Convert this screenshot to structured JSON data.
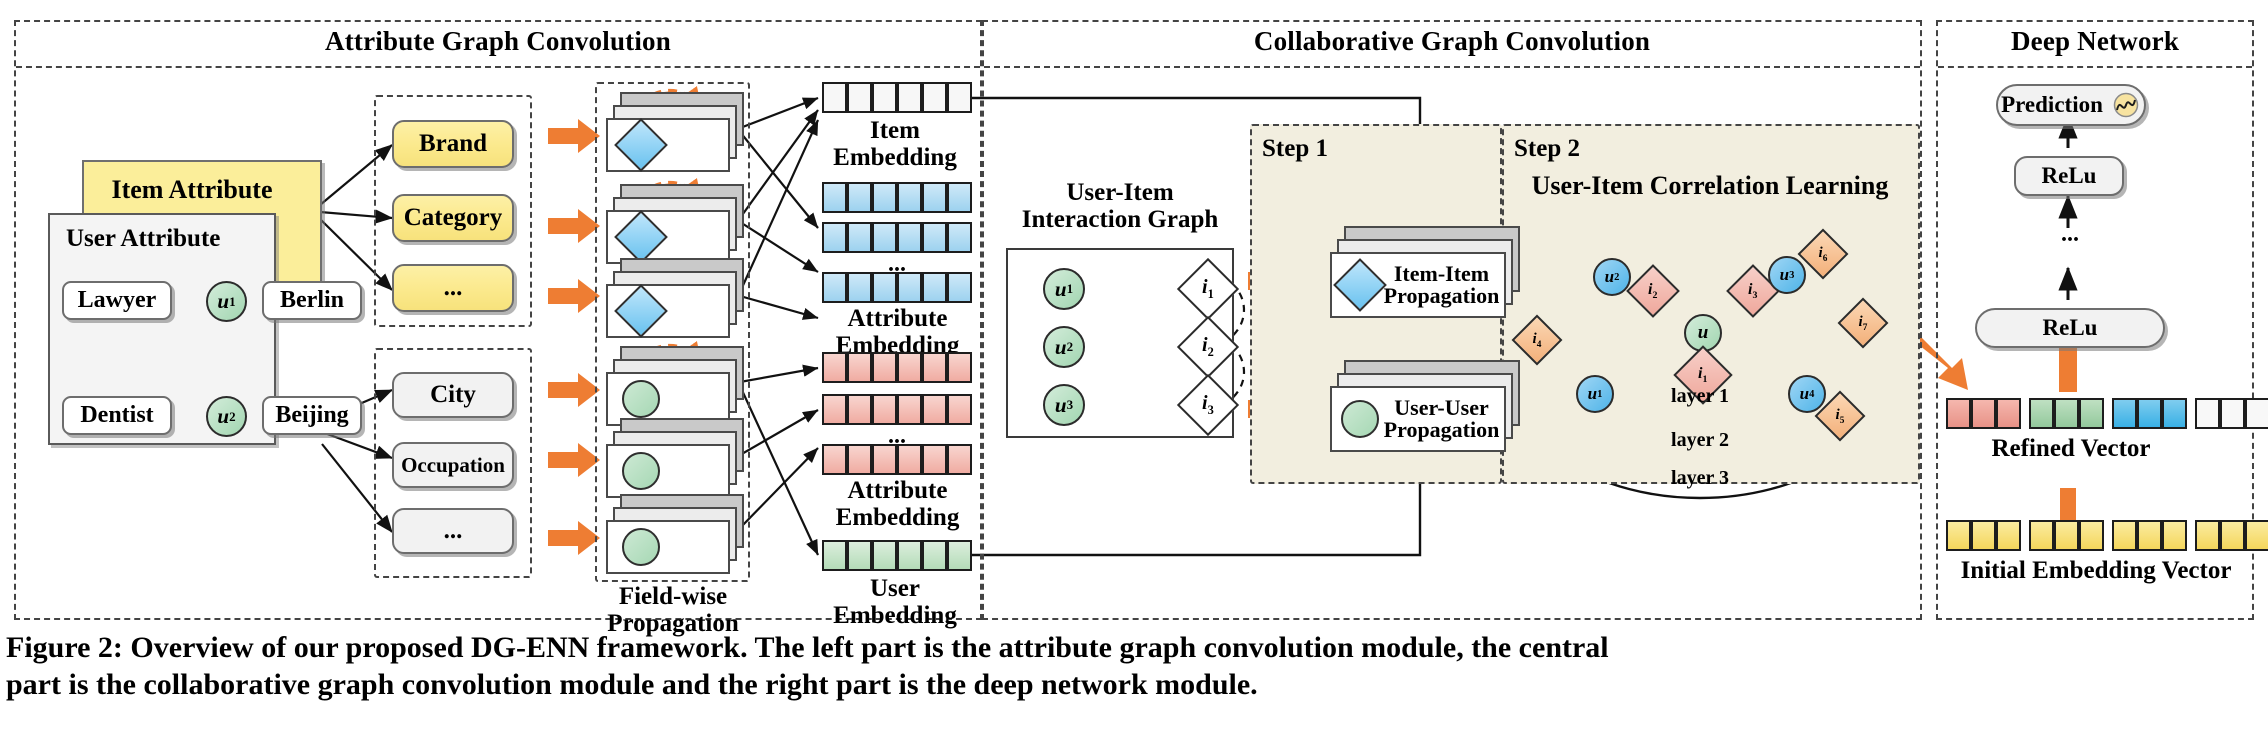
{
  "figure": {
    "caption_line1": "Figure 2: Overview of our proposed DG-ENN framework. The left part is the attribute graph convolution module, the central",
    "caption_line2": "part is the collaborative graph convolution module and the right part is the deep network module."
  },
  "panels": {
    "left": {
      "title": "Attribute Graph Convolution"
    },
    "center": {
      "title": "Collaborative Graph Convolution"
    },
    "right": {
      "title": "Deep Network"
    }
  },
  "left_panel": {
    "item_attribute_label": "Item Attribute",
    "user_attribute_label": "User Attribute",
    "user_graph": {
      "nodes": [
        {
          "id": "lawyer",
          "label": "Lawyer"
        },
        {
          "id": "berlin",
          "label": "Berlin"
        },
        {
          "id": "dentist",
          "label": "Dentist"
        },
        {
          "id": "beijing",
          "label": "Beijing"
        },
        {
          "id": "u1",
          "label": "u",
          "sub": "1"
        },
        {
          "id": "u2",
          "label": "u",
          "sub": "2"
        }
      ]
    },
    "item_fields": [
      "Brand",
      "Category",
      "..."
    ],
    "user_fields": [
      "City",
      "Occupation",
      "..."
    ],
    "field_wise_label_l1": "Field-wise",
    "field_wise_label_l2": "Propagation",
    "item_embedding_label_l1": "Item",
    "item_embedding_label_l2": "Embedding",
    "attribute_embedding_label_l1": "Attribute",
    "attribute_embedding_label_l2": "Embedding",
    "user_embedding_label_l1": "User",
    "user_embedding_label_l2": "Embedding",
    "ellipsis": "...",
    "colors": {
      "item_cell": "#f7f7f7",
      "item_attr_cell": "#a8d9f2",
      "user_attr_cell": "#f3b3ac",
      "user_cell": "#bfdcc2",
      "yellow": "#fbe98c",
      "orange": "#ee7d33"
    }
  },
  "center_panel": {
    "interaction_graph_label_l1": "User-Item",
    "interaction_graph_label_l2": "Interaction Graph",
    "graph_nodes": {
      "users": [
        {
          "label": "u",
          "sub": "1"
        },
        {
          "label": "u",
          "sub": "2"
        },
        {
          "label": "u",
          "sub": "3"
        }
      ],
      "items": [
        {
          "label": "i",
          "sub": "1"
        },
        {
          "label": "i",
          "sub": "2"
        },
        {
          "label": "i",
          "sub": "3"
        }
      ]
    },
    "step1_label": "Step 1",
    "step2_label": "Step 2",
    "step2_title": "User-Item Correlation Learning",
    "propagation_cards": [
      {
        "line1": "Item-Item",
        "line2": "Propagation",
        "glyph": "diamond-icon"
      },
      {
        "line1": "User-User",
        "line2": "Propagation",
        "glyph": "circle-icon"
      }
    ],
    "correlation": {
      "center_node": {
        "label": "u",
        "sub": ""
      },
      "user_nodes": [
        {
          "label": "u",
          "sub": "1"
        },
        {
          "label": "u",
          "sub": "2"
        },
        {
          "label": "u",
          "sub": "3"
        },
        {
          "label": "u",
          "sub": "4"
        }
      ],
      "item_nodes_inner": [
        {
          "label": "i",
          "sub": "1"
        },
        {
          "label": "i",
          "sub": "2"
        },
        {
          "label": "i",
          "sub": "3"
        }
      ],
      "item_nodes_outer": [
        {
          "label": "i",
          "sub": "4"
        },
        {
          "label": "i",
          "sub": "5"
        },
        {
          "label": "i",
          "sub": "6"
        },
        {
          "label": "i",
          "sub": "7"
        }
      ],
      "layer_labels": [
        "layer 1",
        "layer 2",
        "layer 3"
      ]
    }
  },
  "right_panel": {
    "prediction_label": "Prediction",
    "prediction_icon": "sigmoid-curve-icon",
    "relu_top_label": "ReLu",
    "relu_bottom_label": "ReLu",
    "ellipsis": "...",
    "refined_vector_label": "Refined Vector",
    "initial_embedding_label": "Initial Embedding Vector",
    "refined_vector_groups": [
      {
        "color": "#ef9f96",
        "count": 3
      },
      {
        "color": "#a6d2aa",
        "count": 3
      },
      {
        "color": "#5bc0ea",
        "count": 3
      },
      {
        "color": "#f7f7f7",
        "count": 3
      }
    ],
    "initial_vector_groups": [
      {
        "color": "#f7dc74",
        "count": 3
      },
      {
        "color": "#f7dc74",
        "count": 3
      },
      {
        "color": "#f7dc74",
        "count": 3
      },
      {
        "color": "#f7dc74",
        "count": 3
      }
    ]
  }
}
